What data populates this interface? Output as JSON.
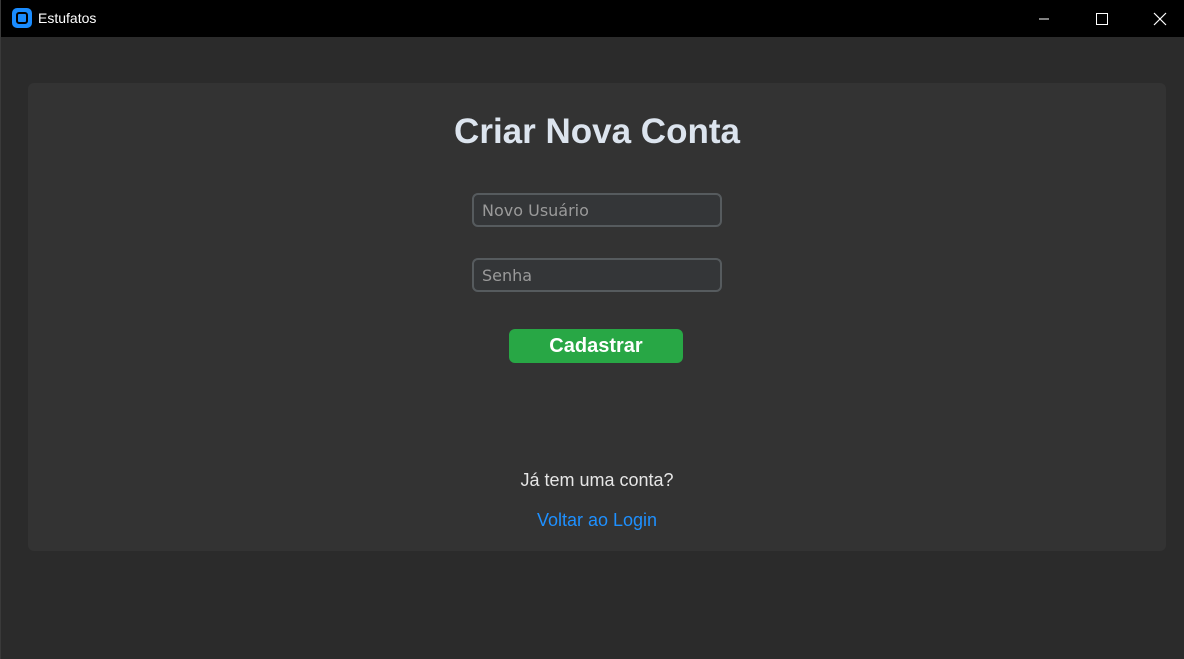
{
  "window": {
    "title": "Estufatos",
    "controls": {
      "minimize": "minimize-icon",
      "maximize": "maximize-icon",
      "close": "close-icon"
    }
  },
  "form": {
    "heading": "Criar Nova Conta",
    "username_placeholder": "Novo Usuário",
    "password_placeholder": "Senha",
    "submit_label": "Cadastrar",
    "login_prompt": "Já tem uma conta?",
    "login_link": "Voltar ao Login"
  },
  "colors": {
    "titlebar": "#000000",
    "background": "#2b2b2b",
    "card": "#333333",
    "accent_button": "#28a745",
    "link": "#1e90ff",
    "app_icon": "#1a8cff"
  }
}
